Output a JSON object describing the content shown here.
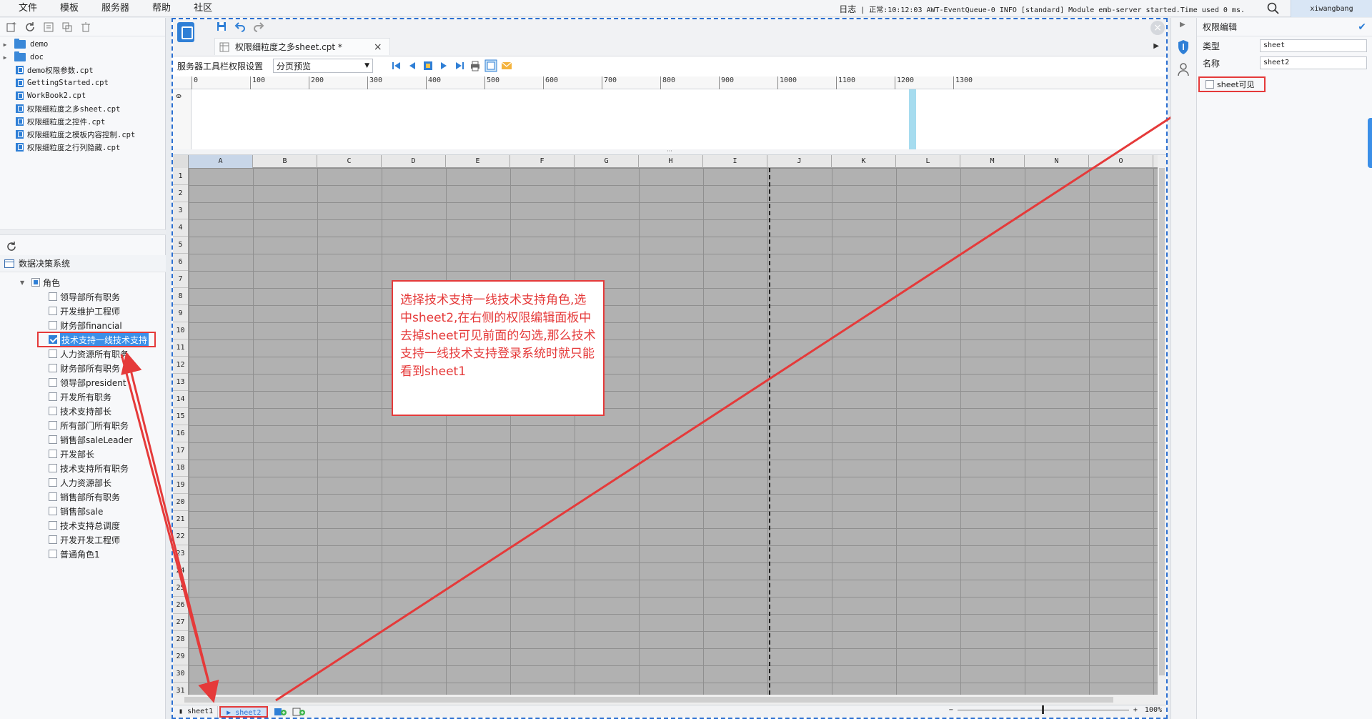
{
  "menu": [
    "文件",
    "模板",
    "服务器",
    "帮助",
    "社区"
  ],
  "status": {
    "log_label": "日志",
    "message": "| 正常:10:12:03 AWT-EventQueue-0 INFO [standard] Module emb-server started.Time used 0 ms.",
    "user": "xiwangbang"
  },
  "file_tree": [
    {
      "name": "demo",
      "type": "folder"
    },
    {
      "name": "doc",
      "type": "folder"
    },
    {
      "name": "demo权限参数.cpt",
      "type": "file"
    },
    {
      "name": "GettingStarted.cpt",
      "type": "file"
    },
    {
      "name": "WorkBook2.cpt",
      "type": "file"
    },
    {
      "name": "权限细粒度之多sheet.cpt",
      "type": "file"
    },
    {
      "name": "权限细粒度之控件.cpt",
      "type": "file"
    },
    {
      "name": "权限细粒度之模板内容控制.cpt",
      "type": "file"
    },
    {
      "name": "权限细粒度之行列隐藏.cpt",
      "type": "file"
    }
  ],
  "decision_system": {
    "title": "数据决策系统",
    "root_role": "角色",
    "roles": [
      {
        "label": "领导部所有职务",
        "checked": false
      },
      {
        "label": "开发维护工程师",
        "checked": false
      },
      {
        "label": "财务部financial",
        "checked": false
      },
      {
        "label": "技术支持一线技术支持",
        "checked": true
      },
      {
        "label": "人力资源所有职务",
        "checked": false
      },
      {
        "label": "财务部所有职务",
        "checked": false
      },
      {
        "label": "领导部president",
        "checked": false
      },
      {
        "label": "开发所有职务",
        "checked": false
      },
      {
        "label": "技术支持部长",
        "checked": false
      },
      {
        "label": "所有部门所有职务",
        "checked": false
      },
      {
        "label": "销售部saleLeader",
        "checked": false
      },
      {
        "label": "开发部长",
        "checked": false
      },
      {
        "label": "技术支持所有职务",
        "checked": false
      },
      {
        "label": "人力资源部长",
        "checked": false
      },
      {
        "label": "销售部所有职务",
        "checked": false
      },
      {
        "label": "销售部sale",
        "checked": false
      },
      {
        "label": "技术支持总调度",
        "checked": false
      },
      {
        "label": "开发开发工程师",
        "checked": false
      },
      {
        "label": "普通角色1",
        "checked": false
      }
    ]
  },
  "editor": {
    "tab_title": "权限细粒度之多sheet.cpt *",
    "tab_close": "×",
    "toolbar_label": "服务器工具栏权限设置",
    "preview_mode": "分页预览",
    "ruler_ticks": [
      "0",
      "100",
      "200",
      "300",
      "400",
      "500",
      "600",
      "700",
      "800",
      "900",
      "1000",
      "1100",
      "1200",
      "1300"
    ],
    "ruler_v": "0",
    "columns": [
      "A",
      "B",
      "C",
      "D",
      "E",
      "F",
      "G",
      "H",
      "I",
      "J",
      "K",
      "L",
      "M",
      "N",
      "O"
    ],
    "rows": [
      "1",
      "2",
      "3",
      "4",
      "5",
      "6",
      "7",
      "8",
      "9",
      "10",
      "11",
      "12",
      "13",
      "14",
      "15",
      "16",
      "17",
      "18",
      "19",
      "20",
      "21",
      "22",
      "23",
      "24",
      "25",
      "26",
      "27",
      "28",
      "29",
      "30",
      "31"
    ],
    "sheets": [
      "sheet1",
      "sheet2"
    ],
    "zoom_minus": "−",
    "zoom_plus": "+",
    "zoom": "100%"
  },
  "annotation": {
    "text": "选择技术支持一线技术支持角色,选中sheet2,在右侧的权限编辑面板中去掉sheet可见前面的勾选,那么技术支持一线技术支持登录系统时就只能看到sheet1"
  },
  "permission_panel": {
    "title": "权限编辑",
    "type_label": "类型",
    "type_value": "sheet",
    "name_label": "名称",
    "name_value": "sheet2",
    "visible_label": "sheet可见",
    "visible_checked": false
  },
  "colors": {
    "accent": "#2f7fd6",
    "highlight": "#e53a3a",
    "selection": "#3b8fe8"
  }
}
